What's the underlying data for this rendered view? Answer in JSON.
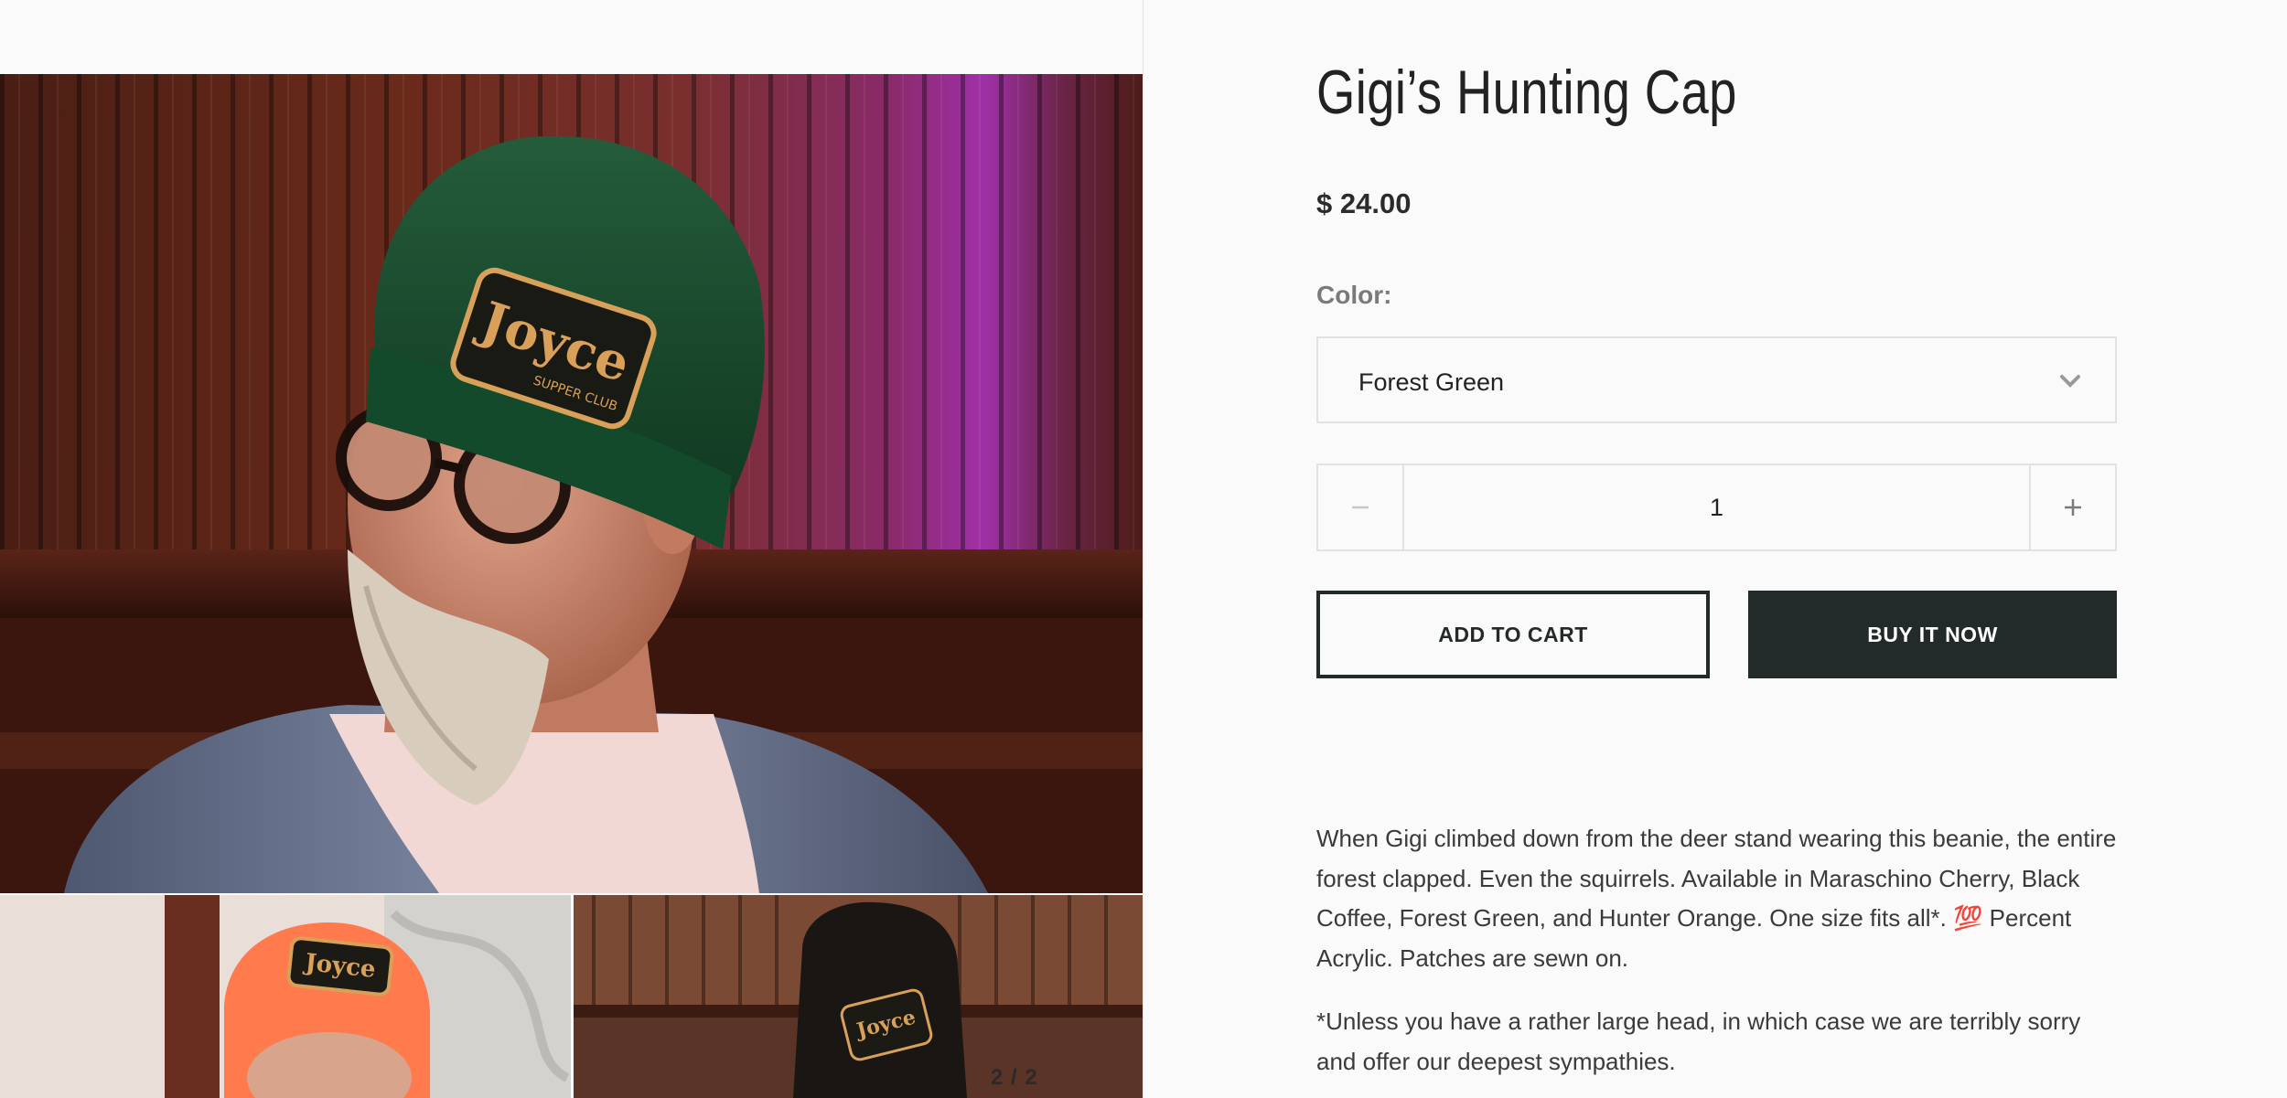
{
  "gallery": {
    "counter": "2 / 2",
    "main_photo_alt": "Man wearing Joyce Supper Club beanie",
    "thumb_1_alt": "Orange beanie",
    "thumb_2_alt": "Black beanie",
    "patch_text": "Joyce",
    "patch_subtext": "SUPPER CLUB"
  },
  "product": {
    "title": "Gigi’s Hunting Cap",
    "price": "$ 24.00",
    "color_label": "Color:",
    "color_selected": "Forest Green",
    "quantity": "1",
    "add_to_cart": "ADD TO CART",
    "buy_now": "BUY IT NOW",
    "description_1": "When Gigi climbed down from the deer stand wearing this beanie, the entire forest clapped. Even the squirrels. Available in Maraschino Cherry, Black Coffee, Forest Green, and Hunter Orange. One size fits all*. 💯 Percent Acrylic. Patches are sewn on.",
    "description_2": "*Unless you have a rather large head, in which case we are terribly sorry and offer our deepest sympathies."
  },
  "icons": {
    "minus": "minus-icon",
    "plus": "plus-icon",
    "chevron": "chevron-down-icon"
  }
}
